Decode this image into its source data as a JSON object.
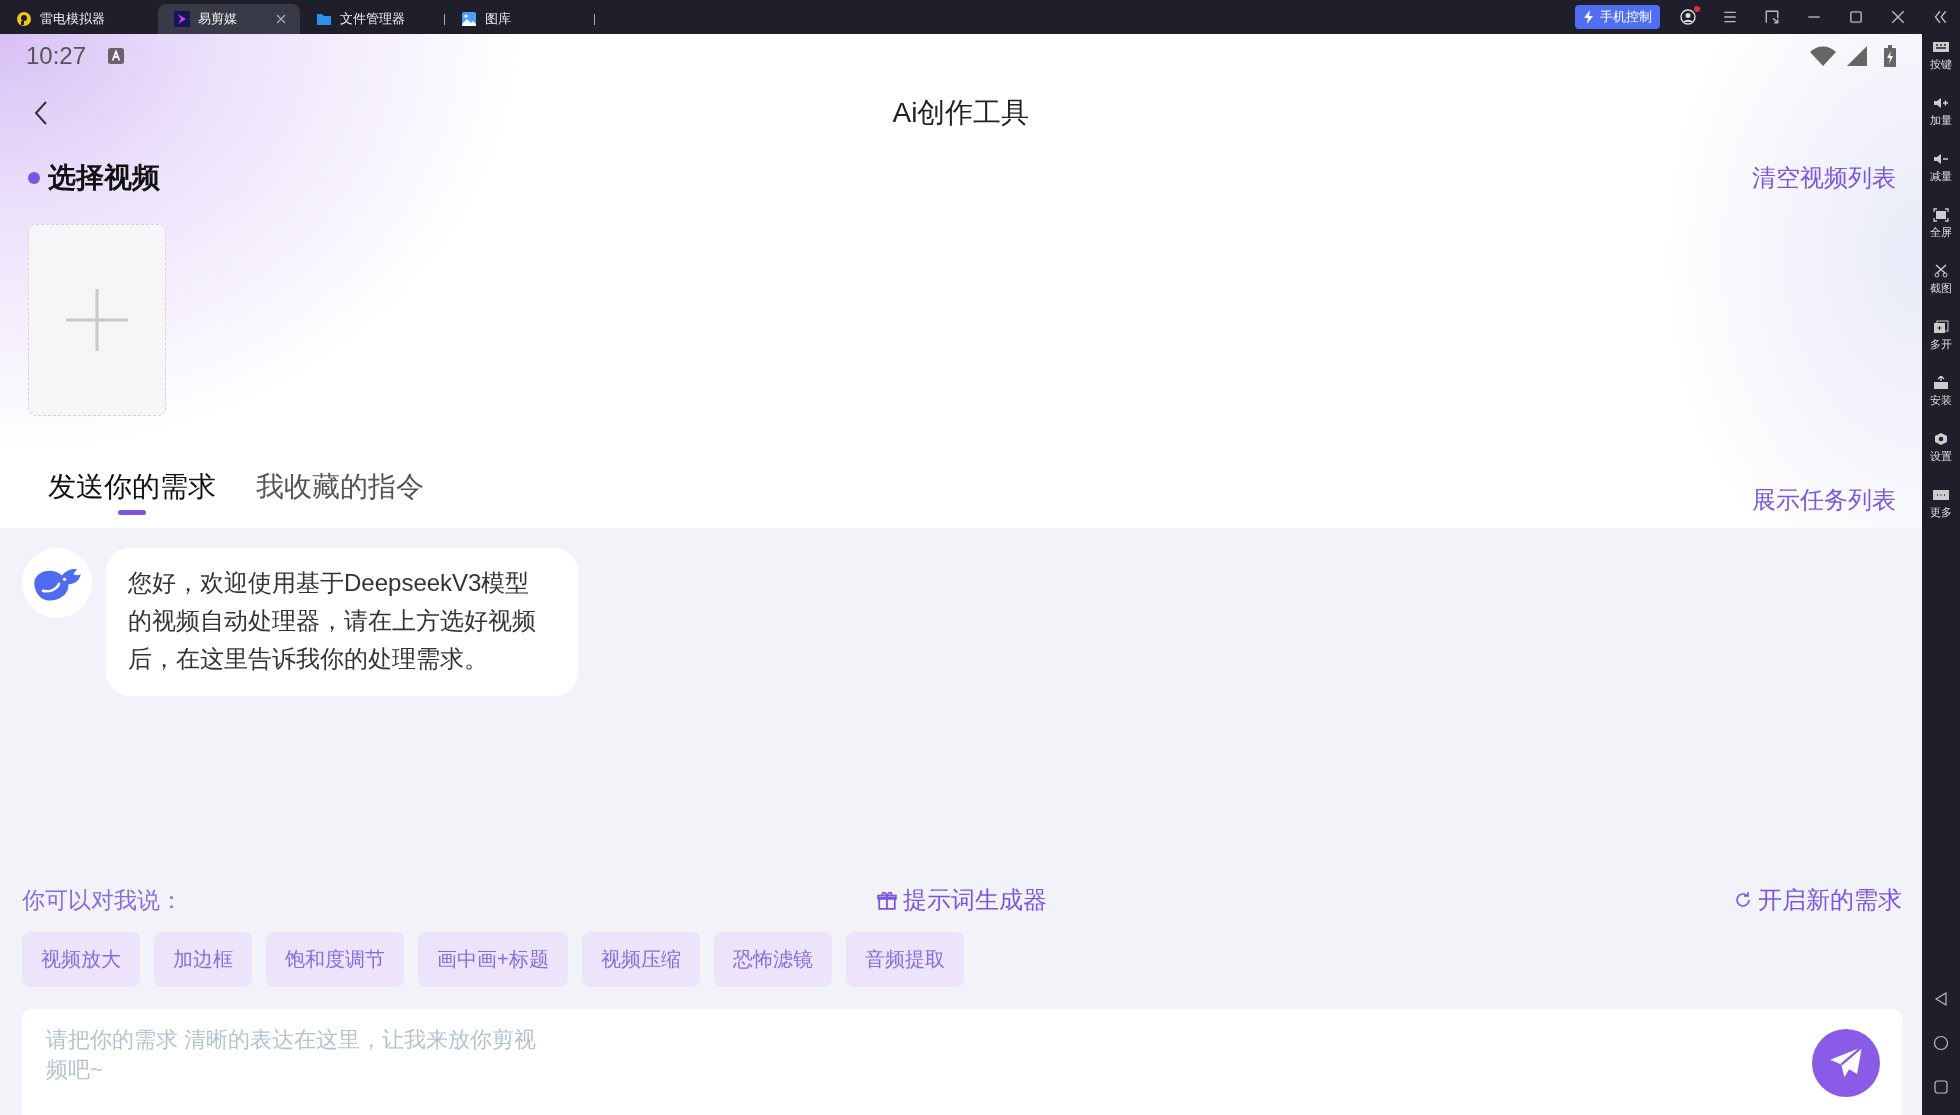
{
  "titlebar": {
    "tabs": [
      {
        "label": "雷电模拟器",
        "selected": false
      },
      {
        "label": "易剪媒",
        "selected": true
      },
      {
        "label": "文件管理器",
        "selected": false
      },
      {
        "label": "图库",
        "selected": false
      }
    ],
    "control_button": "手机控制",
    "notification": true
  },
  "status_bar": {
    "time": "10:27"
  },
  "header": {
    "title": "Ai创作工具"
  },
  "select_section": {
    "title": "选择视频",
    "action": "清空视频列表"
  },
  "tabs": [
    {
      "label": "发送你的需求",
      "selected": true
    },
    {
      "label": "我收藏的指令",
      "selected": false
    }
  ],
  "task_list_link": "展示任务列表",
  "messages": [
    {
      "text": "您好，欢迎使用基于DeepseekV3模型的视频自动处理器，请在上方选好视频后，在这里告诉我你的处理需求。"
    }
  ],
  "suggestions": {
    "label": "你可以对我说：",
    "prompt_generator": "提示词生成器",
    "new_request": "开启新的需求",
    "chips": [
      "视频放大",
      "加边框",
      "饱和度调节",
      "画中画+标题",
      "视频压缩",
      "恐怖滤镜",
      "音频提取"
    ]
  },
  "input": {
    "placeholder": "请把你的需求 清晰的表达在这里，让我来放你剪视频吧~"
  },
  "sidebar": {
    "items": [
      "按键",
      "加量",
      "减量",
      "全屏",
      "截图",
      "多开",
      "安装",
      "设置",
      "更多"
    ]
  }
}
